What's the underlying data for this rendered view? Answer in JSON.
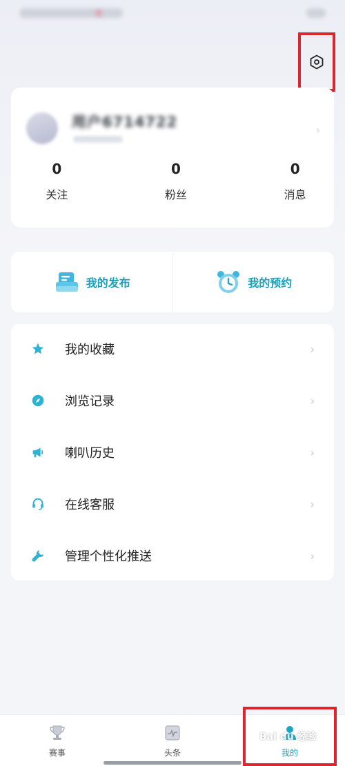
{
  "status_bar": {},
  "profile": {
    "username": "用户6714722",
    "stats": [
      {
        "value": "0",
        "label": "关注"
      },
      {
        "value": "0",
        "label": "粉丝"
      },
      {
        "value": "0",
        "label": "消息"
      }
    ]
  },
  "shortcuts": [
    {
      "label": "我的发布",
      "icon": "publish-icon"
    },
    {
      "label": "我的预约",
      "icon": "alarm-clock-icon"
    }
  ],
  "menu": [
    {
      "label": "我的收藏",
      "icon": "star-icon"
    },
    {
      "label": "浏览记录",
      "icon": "compass-icon"
    },
    {
      "label": "喇叭历史",
      "icon": "megaphone-icon"
    },
    {
      "label": "在线客服",
      "icon": "headset-icon"
    },
    {
      "label": "管理个性化推送",
      "icon": "wrench-icon"
    }
  ],
  "tabbar": [
    {
      "label": "赛事",
      "icon": "trophy-icon"
    },
    {
      "label": "头条",
      "icon": "news-icon"
    },
    {
      "label": "我的",
      "icon": "user-icon",
      "active": true
    }
  ],
  "colors": {
    "accent": "#17a2bb",
    "highlight": "#e0242b"
  }
}
